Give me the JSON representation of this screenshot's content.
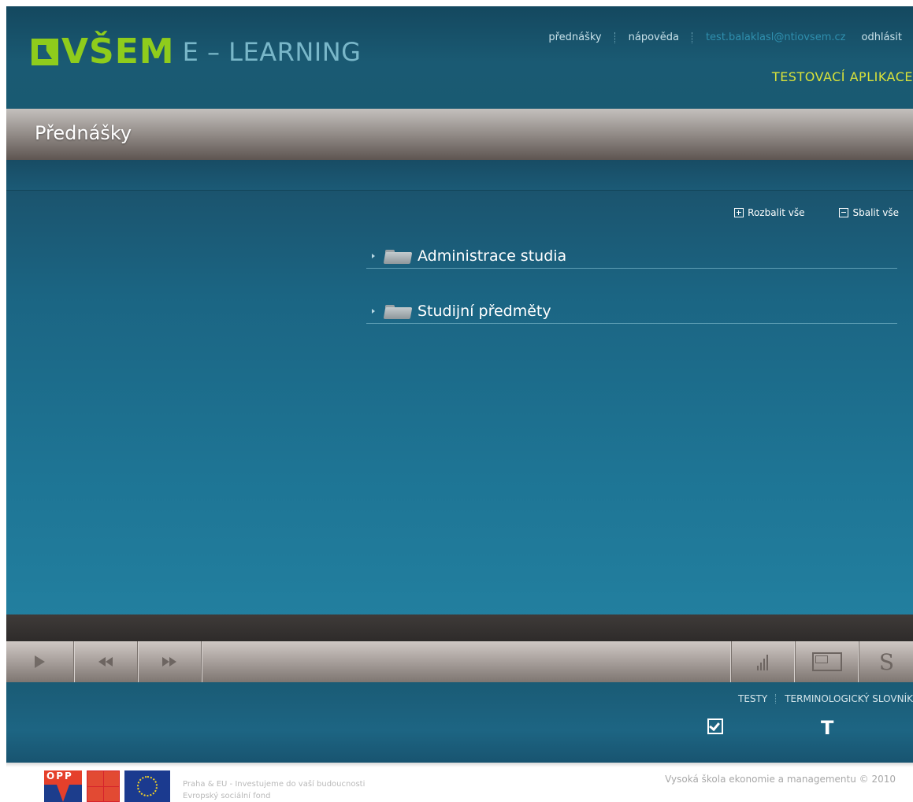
{
  "header": {
    "logo_name": "VŠEM",
    "logo_product": "E – LEARNING",
    "nav": {
      "lectures": "přednášky",
      "help": "nápověda",
      "user_email": "test.balaklasl@ntiovsem.cz",
      "logout": "odhlásit"
    },
    "app_label": "TESTOVACÍ APLIKACE"
  },
  "page": {
    "title": "Přednášky"
  },
  "tree": {
    "expand_all": "Rozbalit vše",
    "collapse_all": "Sbalit vše",
    "items": [
      {
        "label": "Administrace studia",
        "icon": "folder-icon"
      },
      {
        "label": "Studijní předměty",
        "icon": "folder-icon"
      }
    ]
  },
  "player": {
    "controls": [
      "play-icon",
      "rewind-icon",
      "fast-forward-icon",
      "volume-icon",
      "screen-icon",
      "subtitles-icon"
    ],
    "subtitles_glyph": "S"
  },
  "tools": {
    "tests_label": "TESTY",
    "glossary_label": "TERMINOLOGICKÝ SLOVNÍK",
    "glossary_glyph": "T"
  },
  "footer": {
    "left_line1": "Praha & EU - Investujeme do vaší budoucnosti",
    "left_line2": "Evropský sociální fond",
    "oppa_text": "OPP",
    "copyright": "Vysoká škola ekonomie a managementu © 2010"
  },
  "colors": {
    "brand_green": "#8fcc1c",
    "header_blue": "#1a5a73",
    "accent_yellow": "#d9e23a"
  }
}
